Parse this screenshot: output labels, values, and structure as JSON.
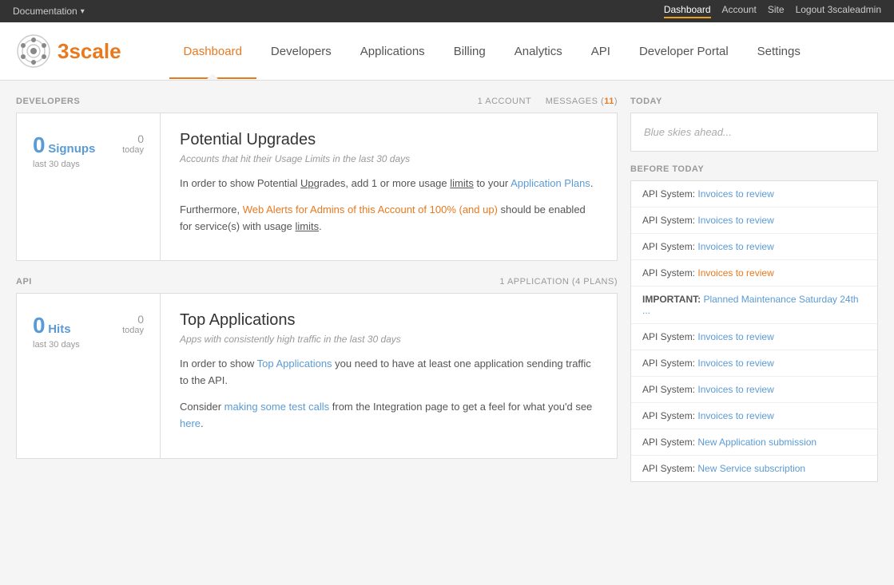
{
  "topbar": {
    "left_label": "Documentation",
    "arrow": "▾",
    "right_links": [
      {
        "label": "Dashboard",
        "active": true
      },
      {
        "label": "Account",
        "active": false
      },
      {
        "label": "Site",
        "active": false
      },
      {
        "label": "Logout 3scaleadmin",
        "active": false
      }
    ]
  },
  "header": {
    "logo_text": "3scale",
    "nav_items": [
      {
        "label": "Dashboard",
        "active": true
      },
      {
        "label": "Developers",
        "active": false
      },
      {
        "label": "Applications",
        "active": false
      },
      {
        "label": "Billing",
        "active": false
      },
      {
        "label": "Analytics",
        "active": false
      },
      {
        "label": "API",
        "active": false
      },
      {
        "label": "Developer Portal",
        "active": false
      },
      {
        "label": "Settings",
        "active": false
      }
    ]
  },
  "developers_section": {
    "title": "DEVELOPERS",
    "account_count": "1 ACCOUNT",
    "messages_label": "MESSAGES (",
    "messages_count": "11",
    "messages_close": ")",
    "stat": {
      "number": "0",
      "label": "Signups",
      "subtitle": "last 30 days",
      "today_number": "0",
      "today_label": "today"
    },
    "info": {
      "title": "Potential Upgrades",
      "subtitle": "Accounts that hit their Usage Limits in the last 30 days",
      "para1_before": "In order to show Potential Upgrades, add ",
      "para1_link": null,
      "para1_text": "In order to show Potential Upgrades, add 1 or more usage limits to your ",
      "para1_link_text": "Application Plans",
      "para1_after": ".",
      "para2_prefix": "Furthermore, ",
      "para2_link_text": "Web Alerts for Admins of this Account of 100% (and up)",
      "para2_suffix": " should be enabled for service(s) with usage limits."
    }
  },
  "api_section": {
    "title": "API",
    "app_count": "1 APPLICATION (4 PLANS)",
    "stat": {
      "number": "0",
      "label": "Hits",
      "subtitle": "last 30 days",
      "today_number": "0",
      "today_label": "today"
    },
    "info": {
      "title": "Top Applications",
      "subtitle": "Apps with consistently high traffic in the last 30 days",
      "para1_text": "In order to show Top Applications you need to have at least one application sending traffic to the API.",
      "para1_link_text": "Top Applications",
      "para2_prefix": "Consider ",
      "para2_link_text": "making some test calls",
      "para2_suffix": " from the Integration page to get a feel for what you'd see here."
    }
  },
  "sidebar": {
    "today_title": "TODAY",
    "today_text": "Blue skies ahead...",
    "before_today_title": "BEFORE TODAY",
    "activity_items": [
      {
        "prefix": "API System: ",
        "link": "Invoices to review",
        "highlight": false,
        "important": false
      },
      {
        "prefix": "API System: ",
        "link": "Invoices to review",
        "highlight": false,
        "important": false
      },
      {
        "prefix": "API System: ",
        "link": "Invoices to review",
        "highlight": false,
        "important": false
      },
      {
        "prefix": "API System: ",
        "link": "Invoices to review",
        "highlight": true,
        "important": false
      },
      {
        "prefix": "IMPORTANT: ",
        "link": "Planned Maintenance Saturday 24th ...",
        "highlight": false,
        "important": true
      },
      {
        "prefix": "API System: ",
        "link": "Invoices to review",
        "highlight": false,
        "important": false
      },
      {
        "prefix": "API System: ",
        "link": "Invoices to review",
        "highlight": false,
        "important": false
      },
      {
        "prefix": "API System: ",
        "link": "Invoices to review",
        "highlight": false,
        "important": false
      },
      {
        "prefix": "API System: ",
        "link": "Invoices to review",
        "highlight": false,
        "important": false
      },
      {
        "prefix": "API System: ",
        "link": "New Application submission",
        "highlight": false,
        "important": false
      },
      {
        "prefix": "API System: ",
        "link": "New Service subscription",
        "highlight": false,
        "important": false
      }
    ]
  }
}
